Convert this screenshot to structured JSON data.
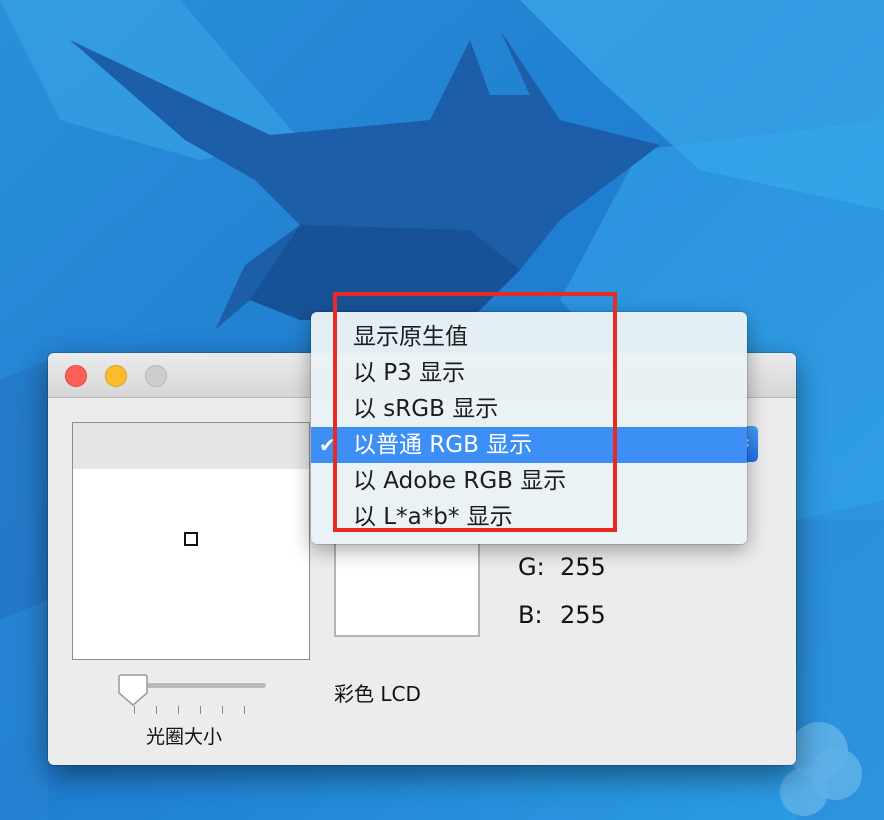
{
  "colors": {
    "desktop_light": "#2f9be4",
    "desktop_dark": "#1a5aa0",
    "selection": "#3d8ff5",
    "annotation_red": "#e82a24"
  },
  "window": {
    "slider_label": "光圈大小",
    "device_label": "彩色 LCD",
    "values": [
      {
        "label": "G:",
        "value": "255"
      },
      {
        "label": "B:",
        "value": "255"
      }
    ],
    "popup_arrow_icon": "up-down-chevron-icon"
  },
  "menu": {
    "items": [
      {
        "label": "显示原生值",
        "checked": false
      },
      {
        "label": "以 P3 显示",
        "checked": false
      },
      {
        "label": "以 sRGB 显示",
        "checked": false
      },
      {
        "label": "以普通 RGB 显示",
        "checked": true
      },
      {
        "label": "以 Adobe RGB 显示",
        "checked": false
      },
      {
        "label": "以 L*a*b* 显示",
        "checked": false
      }
    ],
    "check_glyph": "✔"
  }
}
